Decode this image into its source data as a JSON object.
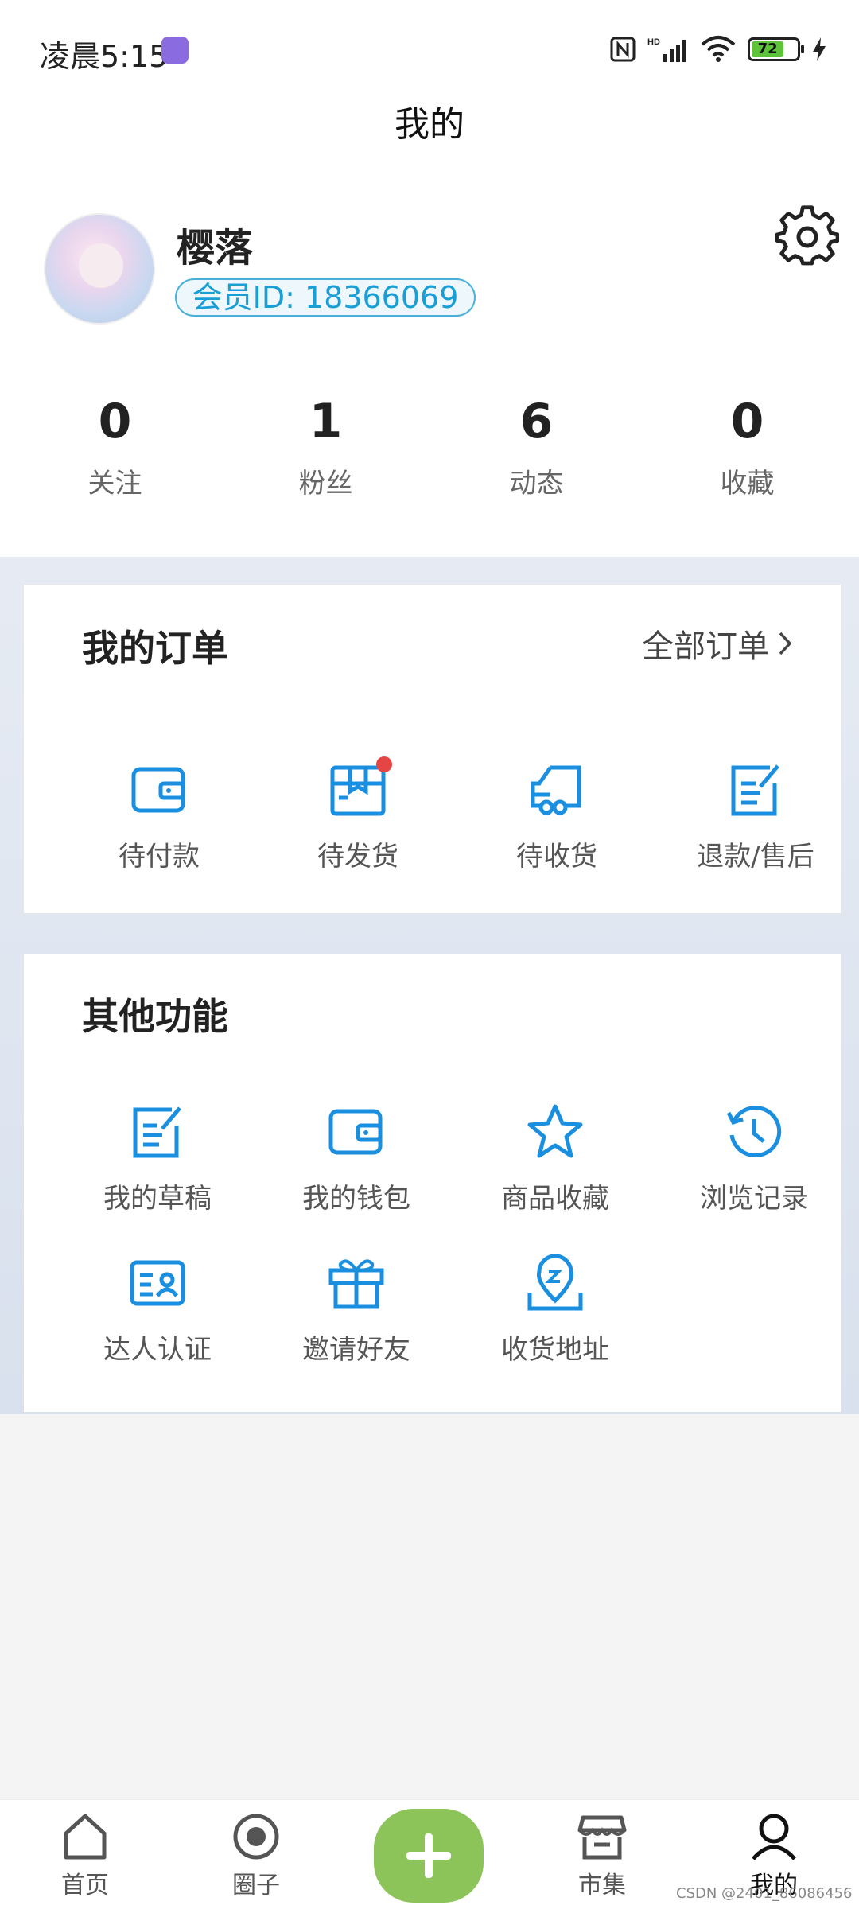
{
  "status_bar": {
    "time": "凌晨5:15",
    "battery": "72"
  },
  "header": {
    "title": "我的"
  },
  "profile": {
    "username": "樱落",
    "member_id": "会员ID: 18366069"
  },
  "stats": [
    {
      "value": "0",
      "label": "关注"
    },
    {
      "value": "1",
      "label": "粉丝"
    },
    {
      "value": "6",
      "label": "动态"
    },
    {
      "value": "0",
      "label": "收藏"
    }
  ],
  "orders": {
    "title": "我的订单",
    "all_label": "全部订单",
    "items": [
      {
        "label": "待付款",
        "icon": "wallet-icon"
      },
      {
        "label": "待发货",
        "icon": "package-icon"
      },
      {
        "label": "待收货",
        "icon": "truck-icon"
      },
      {
        "label": "退款/售后",
        "icon": "edit-note-icon"
      }
    ]
  },
  "other": {
    "title": "其他功能",
    "items": [
      {
        "label": "我的草稿",
        "icon": "draft-icon"
      },
      {
        "label": "我的钱包",
        "icon": "wallet-icon"
      },
      {
        "label": "商品收藏",
        "icon": "star-icon"
      },
      {
        "label": "浏览记录",
        "icon": "history-icon"
      },
      {
        "label": "达人认证",
        "icon": "id-card-icon"
      },
      {
        "label": "邀请好友",
        "icon": "gift-icon"
      },
      {
        "label": "收货地址",
        "icon": "location-icon"
      }
    ]
  },
  "nav": {
    "items": [
      {
        "label": "首页",
        "icon": "home-icon"
      },
      {
        "label": "圈子",
        "icon": "circle-icon"
      },
      {
        "label": "市集",
        "icon": "store-icon"
      },
      {
        "label": "我的",
        "icon": "user-icon"
      }
    ]
  },
  "watermark": "CSDN @2401_86086456",
  "colors": {
    "accent": "#1a8fe0",
    "plus": "#8dc459",
    "badge": "#1a9ed6"
  }
}
